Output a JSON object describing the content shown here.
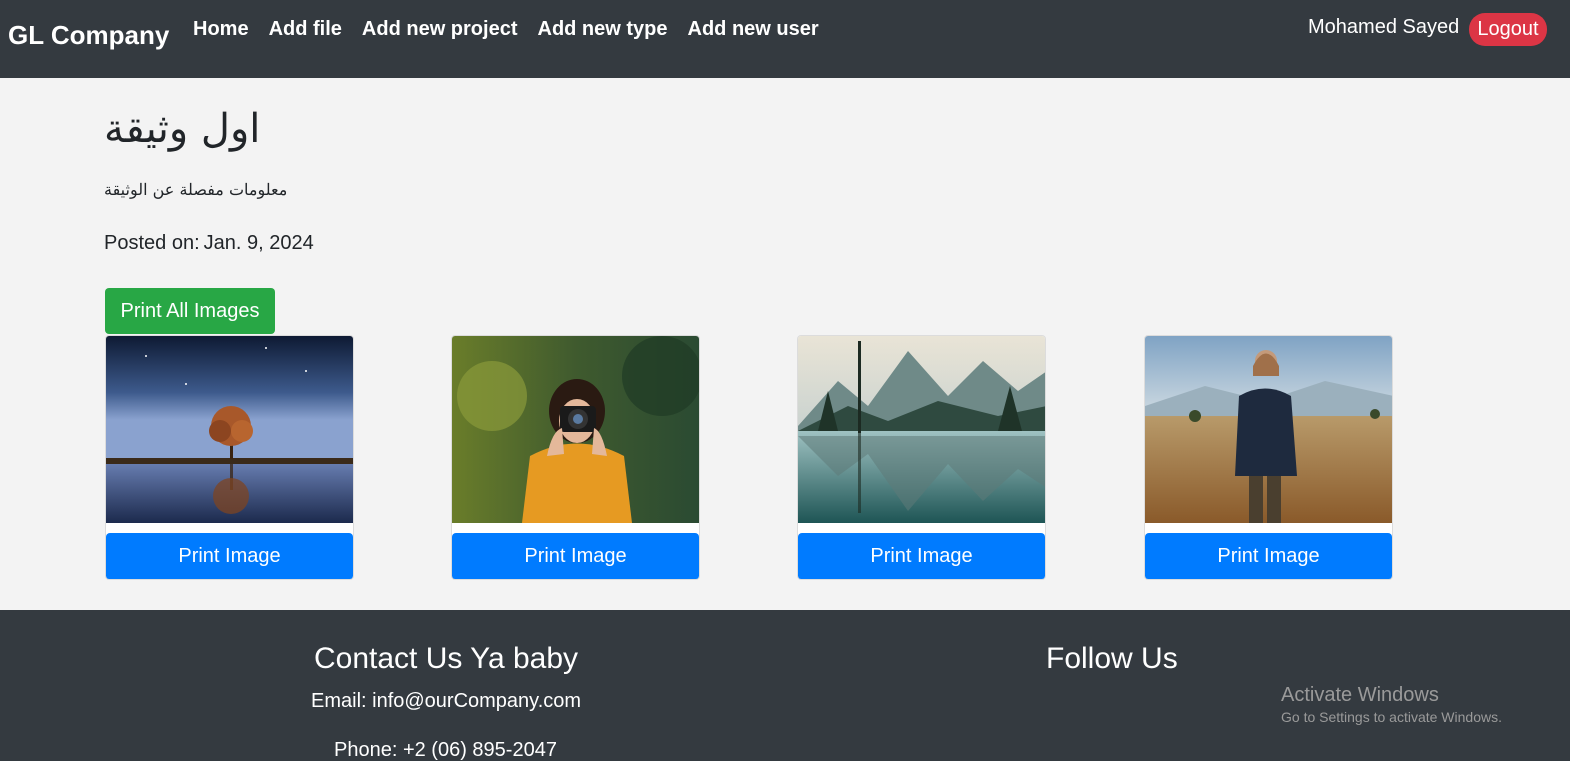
{
  "navbar": {
    "brand": "GL Company",
    "links": [
      "Home",
      "Add file",
      "Add new project",
      "Add new type",
      "Add new user"
    ],
    "user_name": "Mohamed Sayed",
    "logout_label": "Logout",
    "logout_color": "#dc3545",
    "background": "#343a40"
  },
  "document": {
    "title": "اول وثيقة",
    "description": "معلومات مفصلة عن الوثيقة",
    "posted_label": "Posted on:",
    "posted_date": "Jan. 9, 2024",
    "print_all_label": "Print All Images",
    "print_all_color": "#28a745"
  },
  "images": [
    {
      "scene": "tree-reflection-night",
      "button_label": "Print Image"
    },
    {
      "scene": "woman-with-camera",
      "button_label": "Print Image"
    },
    {
      "scene": "mountain-lake",
      "button_label": "Print Image"
    },
    {
      "scene": "man-in-field",
      "button_label": "Print Image"
    }
  ],
  "button_color": "#007bff",
  "footer": {
    "contact_title": "Contact Us Ya baby",
    "email": "Email: info@ourCompany.com",
    "phone": "Phone: +2 (06) 895-2047",
    "follow_title": "Follow Us"
  },
  "watermark": {
    "title": "Activate Windows",
    "subtitle": "Go to Settings to activate Windows."
  }
}
